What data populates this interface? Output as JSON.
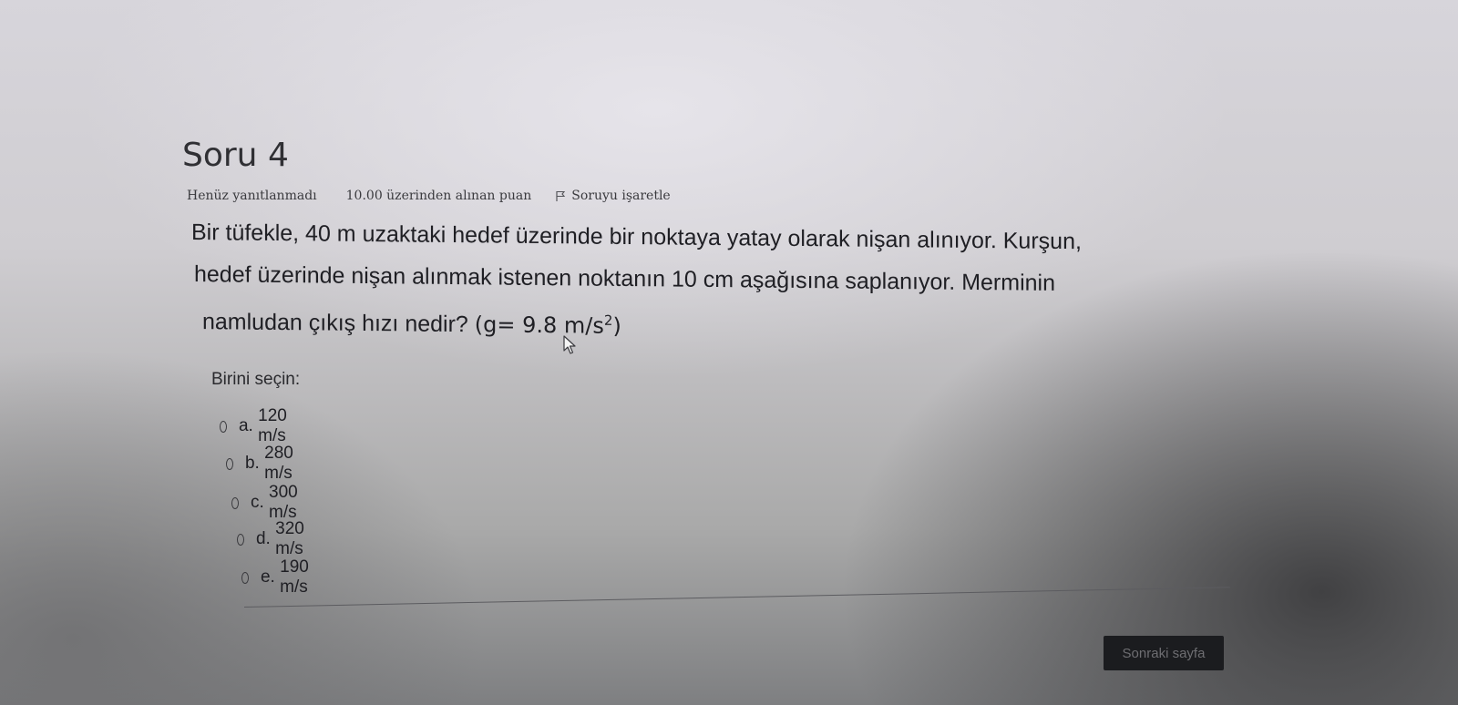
{
  "question": {
    "title": "Soru 4",
    "status": "Henüz yanıtlanmadı",
    "grade": "10.00 üzerinden alınan puan",
    "flag_label": "Soruyu işaretle",
    "text_line1": "Bir tüfekle, 40 m uzaktaki hedef üzerinde bir noktaya yatay olarak nişan alınıyor. Kurşun,",
    "text_line2": "hedef üzerinde nişan alınmak istenen noktanın 10 cm aşağısına saplanıyor. Merminin",
    "text_line3": "namludan çıkış hızı nedir?",
    "formula_main": "(g= 9.8 m/s",
    "formula_exp": "2",
    "formula_close": ")"
  },
  "answer": {
    "prompt": "Birini seçin:",
    "options": [
      {
        "letter": "a.",
        "text": "120 m/s"
      },
      {
        "letter": "b.",
        "text": "280 m/s"
      },
      {
        "letter": "c.",
        "text": "300 m/s"
      },
      {
        "letter": "d.",
        "text": "320 m/s"
      },
      {
        "letter": "e.",
        "text": "190 m/s"
      }
    ]
  },
  "navigation": {
    "next_label": "Sonraki sayfa"
  },
  "icons": {
    "flag": "flag-icon",
    "cursor": "mouse-cursor-icon",
    "radio": "radio-button"
  },
  "colors": {
    "next_button_bg": "#1b1c1f",
    "text": "#1f1f24"
  }
}
